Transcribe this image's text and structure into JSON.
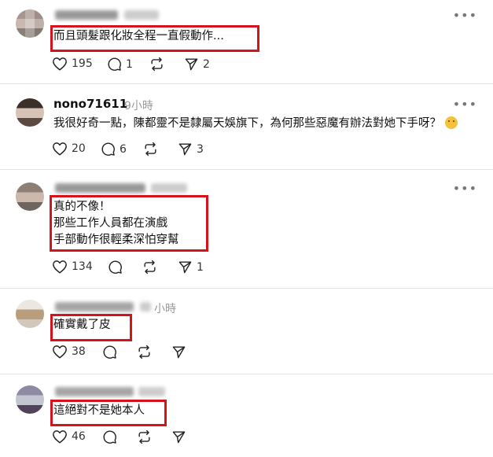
{
  "posts": [
    {
      "username": "",
      "time": "",
      "lines": [
        "而且頭髮跟化妝全程一直假動作..."
      ],
      "likes": "195",
      "replies": "1",
      "reposts": "",
      "shares": "2"
    },
    {
      "username": "nono71611",
      "time": "9小時",
      "lines": [
        "我很好奇一點，陳都靈不是隸屬天娛旗下，為何那些惡魔有辦法對她下手呀？"
      ],
      "likes": "20",
      "replies": "6",
      "reposts": "",
      "shares": "3"
    },
    {
      "username": "",
      "time": "",
      "lines": [
        "真的不像！",
        "那些工作人員都在演戲",
        "手部動作很輕柔深怕穿幫"
      ],
      "likes": "134",
      "replies": "",
      "reposts": "",
      "shares": "1"
    },
    {
      "username": "",
      "time": "小時",
      "lines": [
        "確實戴了皮"
      ],
      "likes": "38",
      "replies": "",
      "reposts": "",
      "shares": ""
    },
    {
      "username": "",
      "time": "",
      "lines": [
        "這絕對不是她本人"
      ],
      "likes": "46",
      "replies": "",
      "reposts": "",
      "shares": ""
    }
  ],
  "icons": {
    "more": "more-horizontal-icon",
    "like": "heart-icon",
    "reply": "comment-icon",
    "repost": "repost-icon",
    "share": "send-icon",
    "emoji": "thinking-face-emoji"
  },
  "colors": {
    "highlight_box": "#d4131a"
  }
}
